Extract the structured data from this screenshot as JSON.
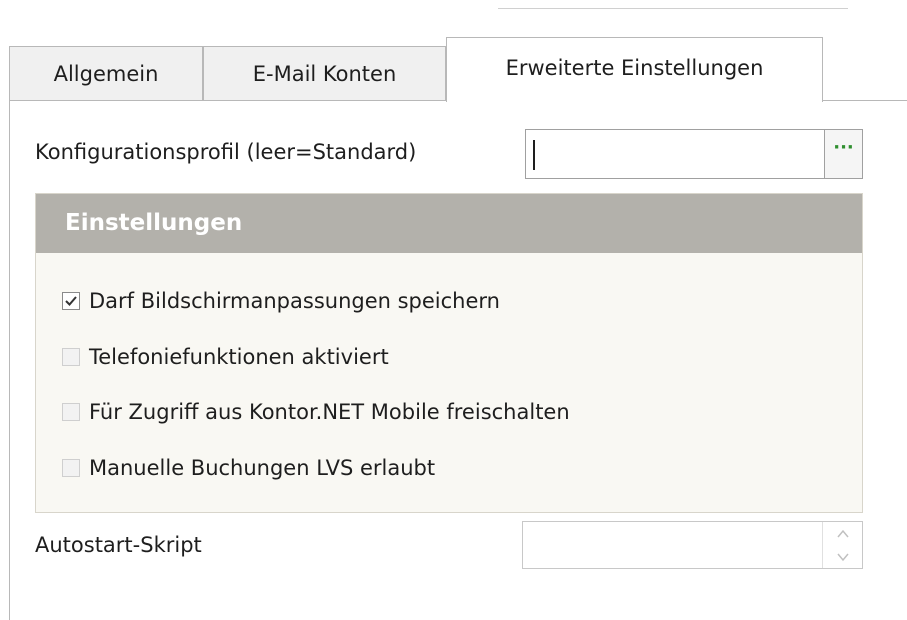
{
  "tabs": [
    {
      "label": "Allgemein",
      "active": false
    },
    {
      "label": "E-Mail Konten",
      "active": false
    },
    {
      "label": "Erweiterte Einstellungen",
      "active": true
    }
  ],
  "config_profile": {
    "label": "Konfigurationsprofil (leer=Standard)",
    "value": "",
    "browse_button_label": "···"
  },
  "settings_group": {
    "title": "Einstellungen",
    "checkboxes": [
      {
        "label": "Darf Bildschirmanpassungen speichern",
        "checked": true,
        "enabled": true
      },
      {
        "label": "Telefoniefunktionen aktiviert",
        "checked": false,
        "enabled": false
      },
      {
        "label": "Für Zugriff aus Kontor.NET Mobile freischalten",
        "checked": false,
        "enabled": false
      },
      {
        "label": "Manuelle Buchungen LVS erlaubt",
        "checked": false,
        "enabled": false
      }
    ]
  },
  "autostart": {
    "label": "Autostart-Skript",
    "value": ""
  },
  "colors": {
    "group_header_bg": "#b3b1ab",
    "group_bg": "#f9f8f3",
    "browse_button_dots": "#2f8f2f"
  }
}
